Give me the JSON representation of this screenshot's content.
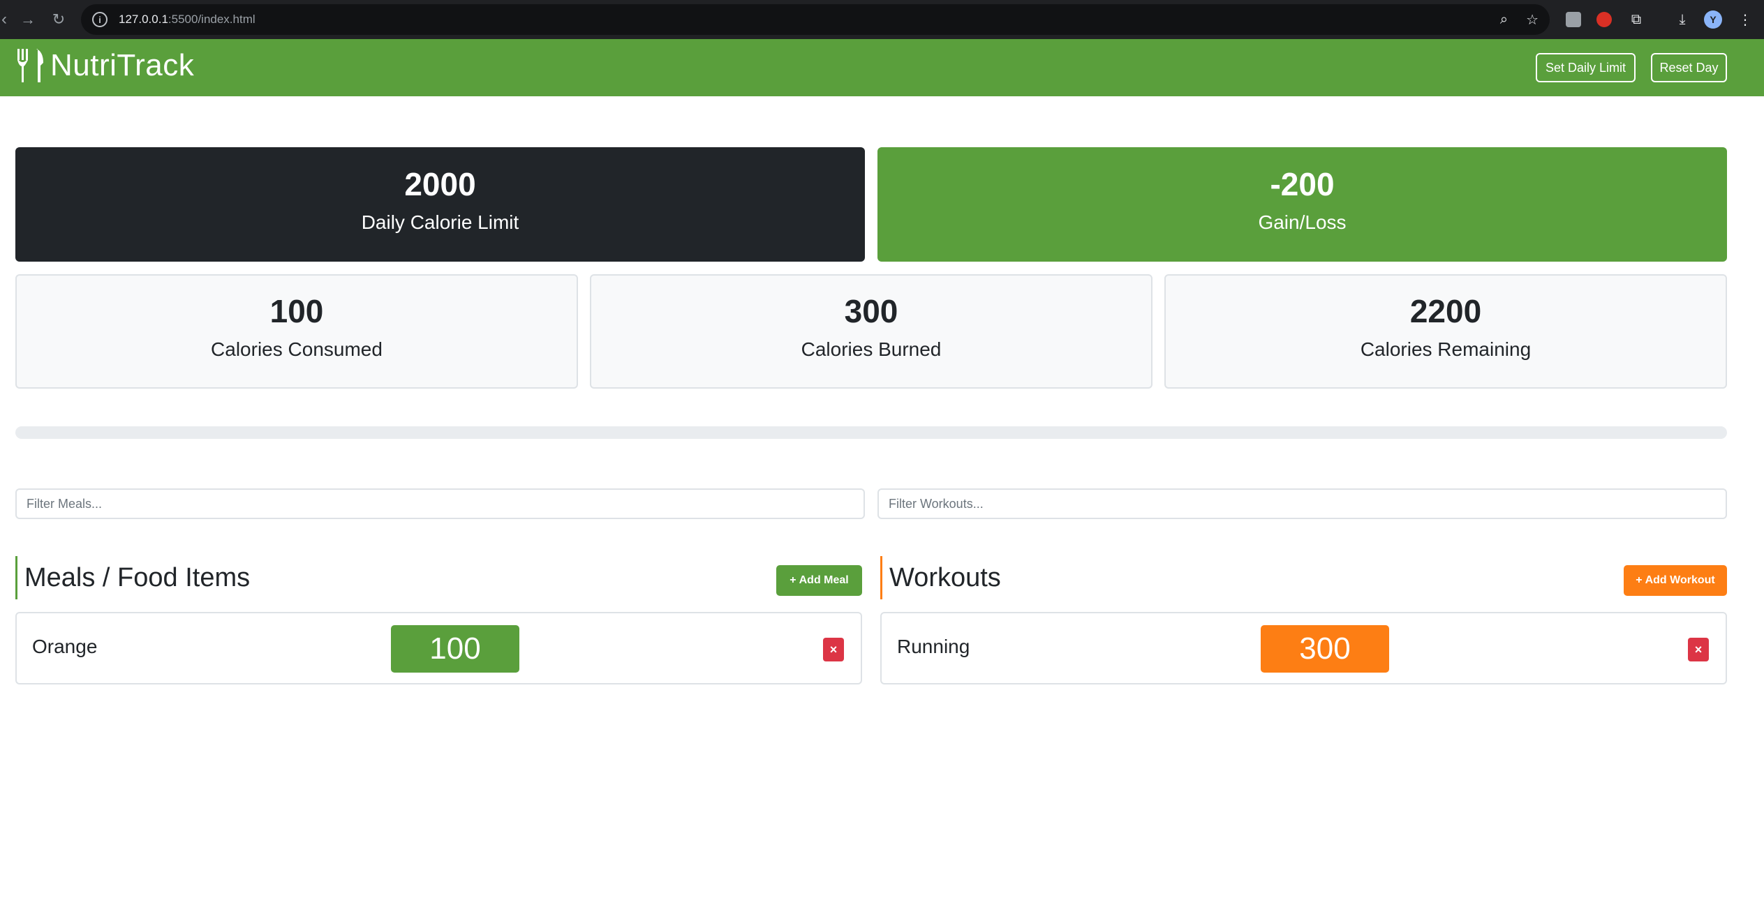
{
  "browser": {
    "url_host": "127.0.0.1",
    "url_path": ":5500/index.html"
  },
  "navbar": {
    "brand": "NutriTrack",
    "set_limit_label": "Set Daily Limit",
    "reset_label": "Reset Day"
  },
  "stats": {
    "limit_value": "2000",
    "limit_label": "Daily Calorie Limit",
    "gain_value": "-200",
    "gain_label": "Gain/Loss",
    "consumed_value": "100",
    "consumed_label": "Calories Consumed",
    "burned_value": "300",
    "burned_label": "Calories Burned",
    "remaining_value": "2200",
    "remaining_label": "Calories Remaining"
  },
  "progress": {
    "fraction": 0.0
  },
  "filters": {
    "meals_placeholder": "Filter Meals...",
    "workouts_placeholder": "Filter Workouts..."
  },
  "meals": {
    "heading": "Meals / Food Items",
    "add_label": "Add Meal",
    "items": [
      {
        "name": "Orange",
        "calories": "100"
      }
    ]
  },
  "workouts": {
    "heading": "Workouts",
    "add_label": "Add Workout",
    "items": [
      {
        "name": "Running",
        "calories": "300"
      }
    ]
  },
  "colors": {
    "green": "#5a9f3c",
    "dark": "#212529",
    "orange": "#fd7e14",
    "danger": "#dc3545"
  },
  "icons": {
    "brand": "utensils-icon",
    "add": "plus-icon",
    "delete": "close-icon"
  }
}
